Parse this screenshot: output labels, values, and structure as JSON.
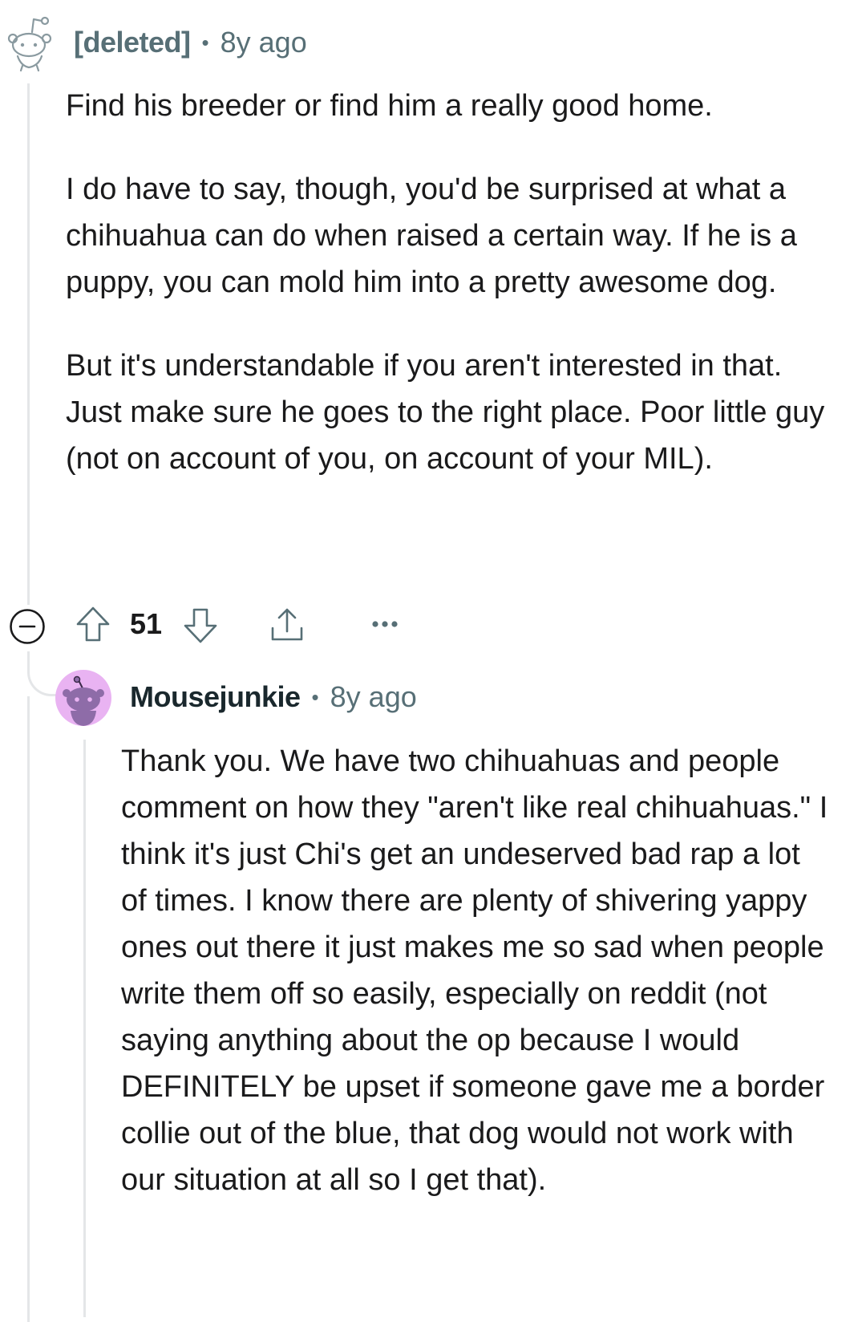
{
  "comments": [
    {
      "author": "[deleted]",
      "time": "8y ago",
      "body": [
        "Find his breeder or find him a really good home.",
        "I do have to say, though, you'd be surprised at what a chihuahua can do when raised a certain way. If he is a puppy, you can mold him into a pretty awesome dog.",
        "But it's understandable if you aren't interested in that. Just make sure he goes to the right place. Poor little guy (not on account of you, on account of your MIL)."
      ],
      "score": "51"
    },
    {
      "author": "Mousejunkie",
      "time": "8y ago",
      "body": [
        "Thank you. We have two chihuahuas and people comment on how they \"aren't like real chihuahuas.\" I think it's just Chi's get an undeserved bad rap a lot of times. I know there are plenty of shivering yappy ones out there it just makes me so sad when people write them off so easily, especially on reddit (not saying anything about the op because I would DEFINITELY be upset if someone gave me a border collie out of the blue, that dog would not work with our situation at all so I get that)."
      ]
    }
  ],
  "separator": "•",
  "icons": {
    "avatar_deleted": "snoo-outline-icon",
    "avatar_user": "snoo-avatar-icon",
    "collapse": "collapse-minus-icon",
    "upvote": "upvote-arrow-icon",
    "downvote": "downvote-arrow-icon",
    "share": "share-icon",
    "more": "more-options-icon"
  },
  "colors": {
    "meta": "#576f76",
    "thread_line": "#e4e6e8",
    "avatar_bg": "#e9b3f2",
    "avatar_snoo": "#8e6ca8"
  }
}
